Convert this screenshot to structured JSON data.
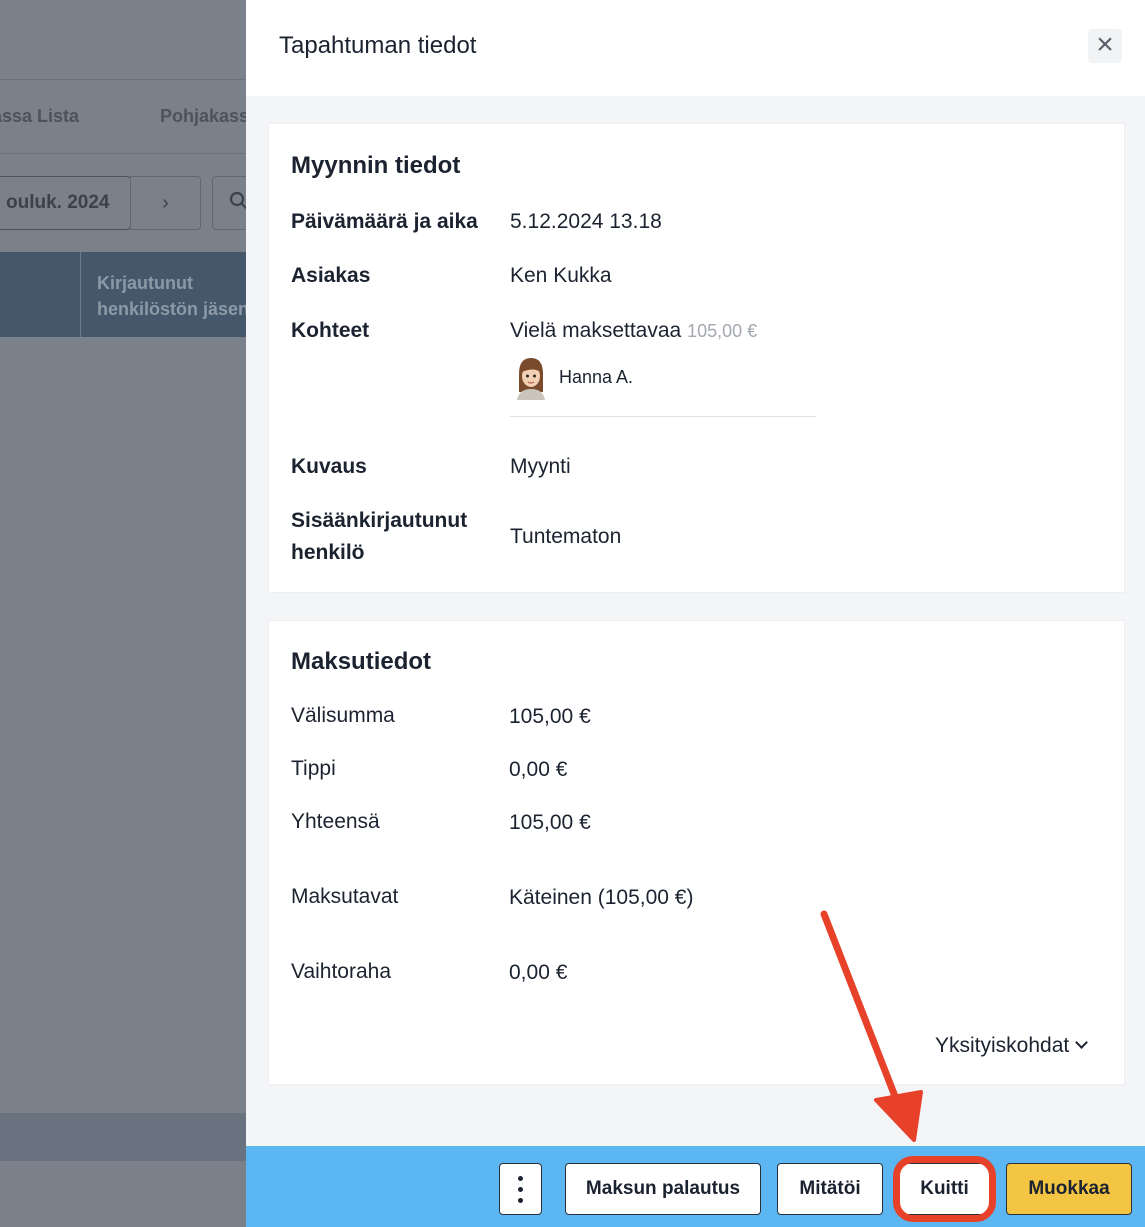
{
  "background": {
    "tabs": [
      "assa Lista",
      "Pohjakass"
    ],
    "date_label": "ouluk. 2024",
    "next_symbol": "›",
    "table_header": [
      "Kirjautunut",
      "henkilöstön jäsen"
    ]
  },
  "drawer": {
    "title": "Tapahtuman tiedot",
    "close_symbol": "×",
    "sale": {
      "title": "Myynnin tiedot",
      "date_label": "Päivämäärä ja aika",
      "date_value": "5.12.2024 13.18",
      "customer_label": "Asiakas",
      "customer_value": "Ken Kukka",
      "items_label": "Kohteet",
      "item_name": "Vielä maksettavaa",
      "item_price": "105,00 €",
      "staff_name": "Hanna A.",
      "description_label": "Kuvaus",
      "description_value": "Myynti",
      "logged_in_label_1": "Sisäänkirjautunut",
      "logged_in_label_2": "henkilö",
      "logged_in_value": "Tuntematon"
    },
    "payment": {
      "title": "Maksutiedot",
      "subtotal_label": "Välisumma",
      "subtotal_value": "105,00 €",
      "tip_label": "Tippi",
      "tip_value": "0,00 €",
      "total_label": "Yhteensä",
      "total_value": "105,00 €",
      "methods_label": "Maksutavat",
      "methods_value": "Käteinen (105,00 €)",
      "change_label": "Vaihtoraha",
      "change_value": "0,00 €",
      "details_link": "Yksityiskohdat"
    },
    "actions": {
      "refund": "Maksun palautus",
      "void": "Mitätöi",
      "receipt": "Kuitti",
      "edit": "Muokkaa"
    }
  },
  "colors": {
    "overlay": "#7b818b",
    "action_bar": "#5cb6f2",
    "edit_button": "#f4c542",
    "annotation": "#e8412a"
  }
}
